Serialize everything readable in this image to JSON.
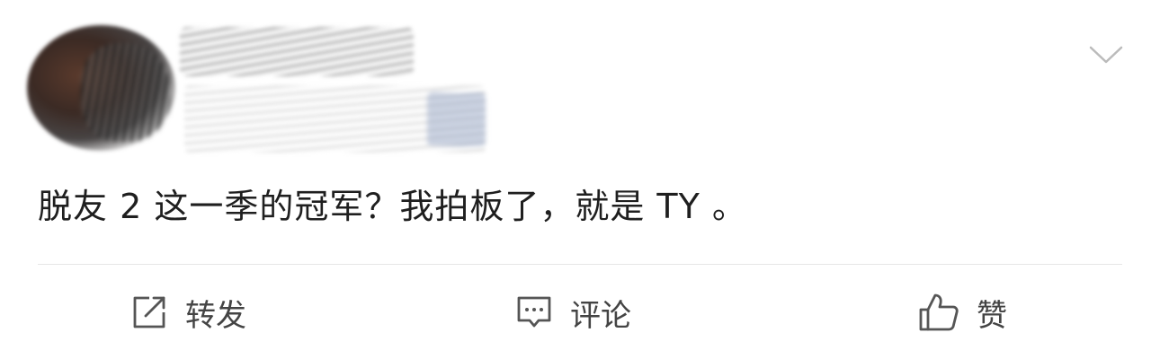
{
  "post": {
    "menu_icon": "chevron-down-icon",
    "text": "脱友 2 这一季的冠军？我拍板了，就是 TY 。"
  },
  "actions": {
    "repost": {
      "icon": "repost-icon",
      "label": "转发"
    },
    "comment": {
      "icon": "comment-icon",
      "label": "评论"
    },
    "like": {
      "icon": "thumbs-up-icon",
      "label": "赞"
    }
  },
  "colors": {
    "text": "#1f1f1f",
    "action_text": "#444444",
    "icon": "#555555",
    "divider": "#e6e6e6",
    "chevron": "#bbbbbb"
  }
}
